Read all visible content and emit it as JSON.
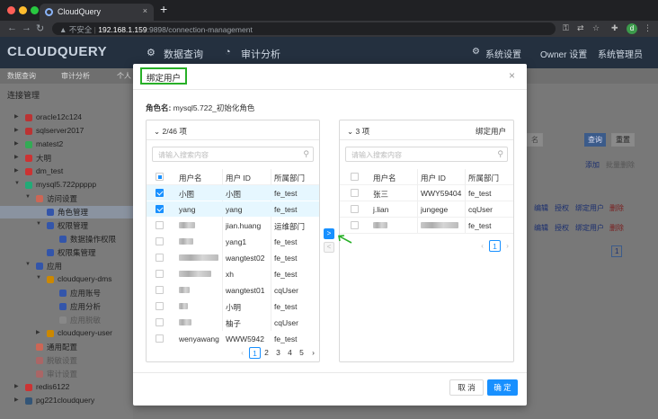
{
  "browser": {
    "tab_title": "CloudQuery",
    "new_tab": "+",
    "insecure": "不安全",
    "url_host": "192.168.1.159",
    "url_path": ":9898/connection-management",
    "avatar_letter": "d"
  },
  "app": {
    "logo": "CLOUDQUERY",
    "nav": {
      "data_query": "数据查询",
      "audit": "审计分析",
      "system_settings": "系统设置",
      "owner_settings": "Owner 设置",
      "system_admin": "系统管理员"
    },
    "tabs": [
      "数据查询",
      "审计分析",
      "个人"
    ]
  },
  "sidebar": {
    "title": "连接管理",
    "items": [
      {
        "label": "oracle12c124"
      },
      {
        "label": "sqlserver2017"
      },
      {
        "label": "matest2"
      },
      {
        "label": "大明"
      },
      {
        "label": "dm_test"
      },
      {
        "label": "mysql5.722ppppp"
      },
      {
        "label": "访问设置"
      },
      {
        "label": "角色管理"
      },
      {
        "label": "权限管理"
      },
      {
        "label": "数据操作权限"
      },
      {
        "label": "权限集管理"
      },
      {
        "label": "应用"
      },
      {
        "label": "cloudquery-dms"
      },
      {
        "label": "应用账号"
      },
      {
        "label": "应用分析"
      },
      {
        "label": "应用脱敏"
      },
      {
        "label": "cloudquery-user"
      },
      {
        "label": "通用配置"
      },
      {
        "label": "脱敏设置"
      },
      {
        "label": "审计设置"
      },
      {
        "label": "redis6122"
      },
      {
        "label": "pg221cloudquery"
      }
    ]
  },
  "background_page": {
    "search_fragment": "名",
    "query_button": "查询",
    "reset_button": "重置",
    "add_link": "添加",
    "batch_delete": "批量删除",
    "row_actions": {
      "edit": "编辑",
      "grant": "授权",
      "bind": "绑定用户",
      "delete": "删除"
    },
    "page_current": "1"
  },
  "modal": {
    "title": "绑定用户",
    "close": "×",
    "role_label": "角色名:",
    "role_value": "mysql5.722_初始化角色",
    "left": {
      "count": "2/46 项",
      "search_placeholder": "请输入搜索内容",
      "columns": [
        "用户名",
        "用户 ID",
        "所属部门"
      ],
      "rows": [
        {
          "name": "小图",
          "id": "小图",
          "dept": "fe_test",
          "checked": true
        },
        {
          "name": "yang",
          "id": "yang",
          "dept": "fe_test",
          "checked": true
        },
        {
          "name": "",
          "id": "jian.huang",
          "dept": "运维部门",
          "checked": false
        },
        {
          "name": "",
          "id": "yang1",
          "dept": "fe_test",
          "checked": false
        },
        {
          "name": "",
          "id": "wangtest02",
          "dept": "fe_test",
          "checked": false
        },
        {
          "name": "",
          "id": "xh",
          "dept": "fe_test",
          "checked": false
        },
        {
          "name": "",
          "id": "wangtest01",
          "dept": "cqUser",
          "checked": false
        },
        {
          "name": "",
          "id": "小明",
          "dept": "fe_test",
          "checked": false
        },
        {
          "name": "",
          "id": "柚子",
          "dept": "cqUser",
          "checked": false
        },
        {
          "name": "wenyawang",
          "id": "WWW5942",
          "dept": "fe_test",
          "checked": false
        }
      ],
      "pages": [
        "1",
        "2",
        "3",
        "4",
        "5"
      ],
      "prev": "‹",
      "next": "›"
    },
    "right": {
      "count": "3 项",
      "title": "绑定用户",
      "search_placeholder": "请输入搜索内容",
      "columns": [
        "用户名",
        "用户 ID",
        "所属部门"
      ],
      "rows": [
        {
          "name": "张三",
          "id": "WWY59404",
          "dept": "fe_test"
        },
        {
          "name": "j.lian",
          "id": "jungege",
          "dept": "cqUser"
        },
        {
          "name": "",
          "id": "",
          "dept": "fe_test"
        }
      ],
      "pages": [
        "1"
      ],
      "prev": "‹",
      "next": "›"
    },
    "transfer_right": ">",
    "transfer_left": "<",
    "cancel": "取 消",
    "ok": "确 定"
  }
}
